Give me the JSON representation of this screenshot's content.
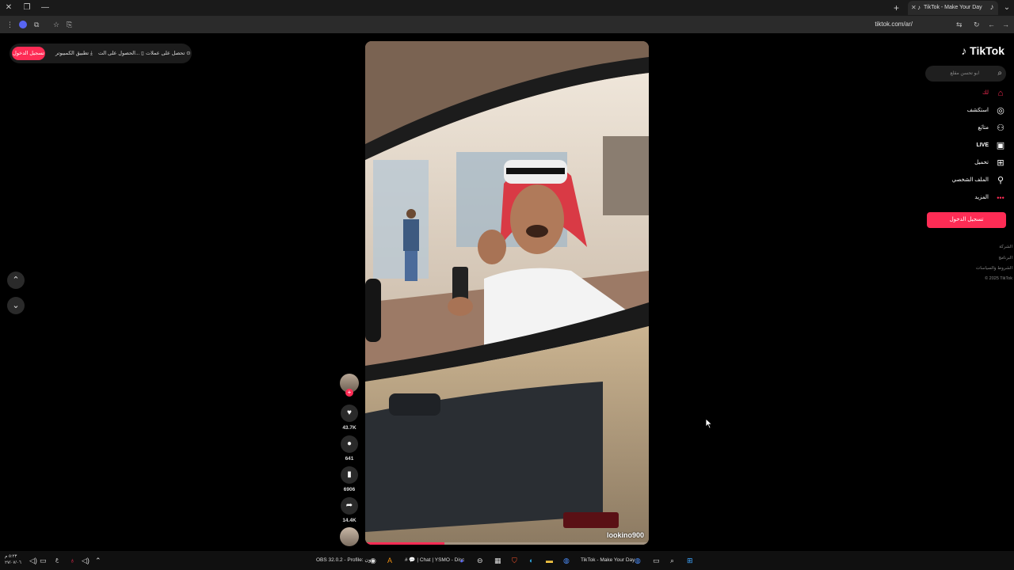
{
  "browser": {
    "tab_title": "TikTok - Make Your Day",
    "url": "tiktok.com/ar/"
  },
  "promo": {
    "login_label": "تسجيل الدخول",
    "desktop_app_label": "تطبيق الكمبيوتر",
    "get_app_label": "الحصول على الت...",
    "get_coins_label": "تحصل على عملات"
  },
  "video": {
    "author": "lookino900",
    "progress": 0.28
  },
  "actions": {
    "likes": "43.7K",
    "comments": "641",
    "saves": "6906",
    "shares": "14.4K"
  },
  "sidebar": {
    "logo": "TikTok",
    "search_placeholder": "ابو تحسن مقلع",
    "nav": [
      {
        "label": "لك",
        "icon": "home-icon",
        "active": true
      },
      {
        "label": "استكشف",
        "icon": "compass-icon"
      },
      {
        "label": "متابَع",
        "icon": "following-icon"
      },
      {
        "label": "LIVE",
        "icon": "live-icon"
      },
      {
        "label": "تحميل",
        "icon": "upload-icon"
      },
      {
        "label": "الملف الشخصي",
        "icon": "profile-icon"
      },
      {
        "label": "المزيد",
        "icon": "more-icon"
      }
    ],
    "login_label": "تسجيل الدخول",
    "footer": [
      "الشركة",
      "البرنامج",
      "الشروط والسياسات",
      "© 2025 TikTok"
    ]
  },
  "taskbar": {
    "clock_time": "٥:٢٣ م",
    "clock_date": "٢٧/٠٧/٠٦",
    "lang": "ع",
    "obs_label": "OBS 32.0.2 - Profile: بدون",
    "discord_label": "# 💬 | Chat | YSMO - Disc",
    "tiktok_label": "TikTok - Make Your Day"
  },
  "colors": {
    "accent": "#fe2c55",
    "background": "#000000"
  }
}
